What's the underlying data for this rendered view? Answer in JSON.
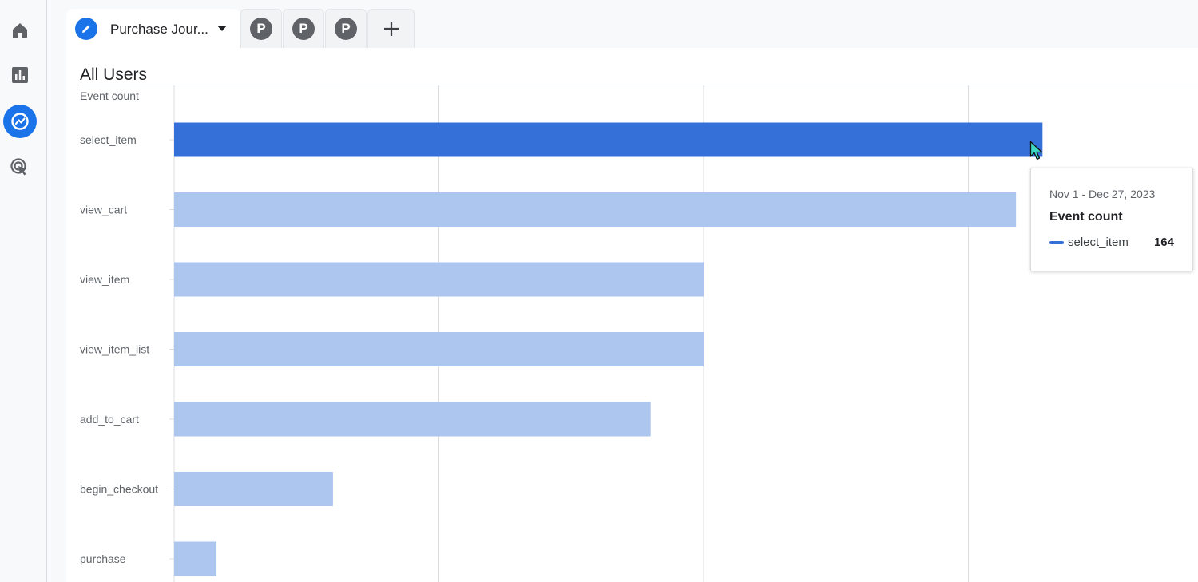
{
  "nav": {
    "items": [
      {
        "icon": "home-icon",
        "active": false
      },
      {
        "icon": "reports-icon",
        "active": false
      },
      {
        "icon": "explore-icon",
        "active": true
      },
      {
        "icon": "advertising-icon",
        "active": false
      }
    ]
  },
  "tabs": {
    "active_label": "Purchase Jour...",
    "segments": [
      "P",
      "P",
      "P"
    ],
    "add_label": "+"
  },
  "segment": {
    "title": "All Users",
    "metric_label": "Event count"
  },
  "colors": {
    "highlight_bar": "#3470d8",
    "bar": "#adc6f0",
    "accent": "#1a73e8"
  },
  "chart_data": {
    "type": "bar",
    "orientation": "horizontal",
    "categories": [
      "select_item",
      "view_cart",
      "view_item",
      "view_item_list",
      "add_to_cart",
      "begin_checkout",
      "purchase"
    ],
    "values": [
      164,
      159,
      100,
      100,
      90,
      30,
      8
    ],
    "highlighted": "select_item",
    "ylabel": "Event count",
    "xlim": [
      0,
      200
    ],
    "grid": true
  },
  "tooltip": {
    "date_range": "Nov 1 - Dec 27, 2023",
    "metric": "Event count",
    "series": "select_item",
    "value": "164"
  }
}
